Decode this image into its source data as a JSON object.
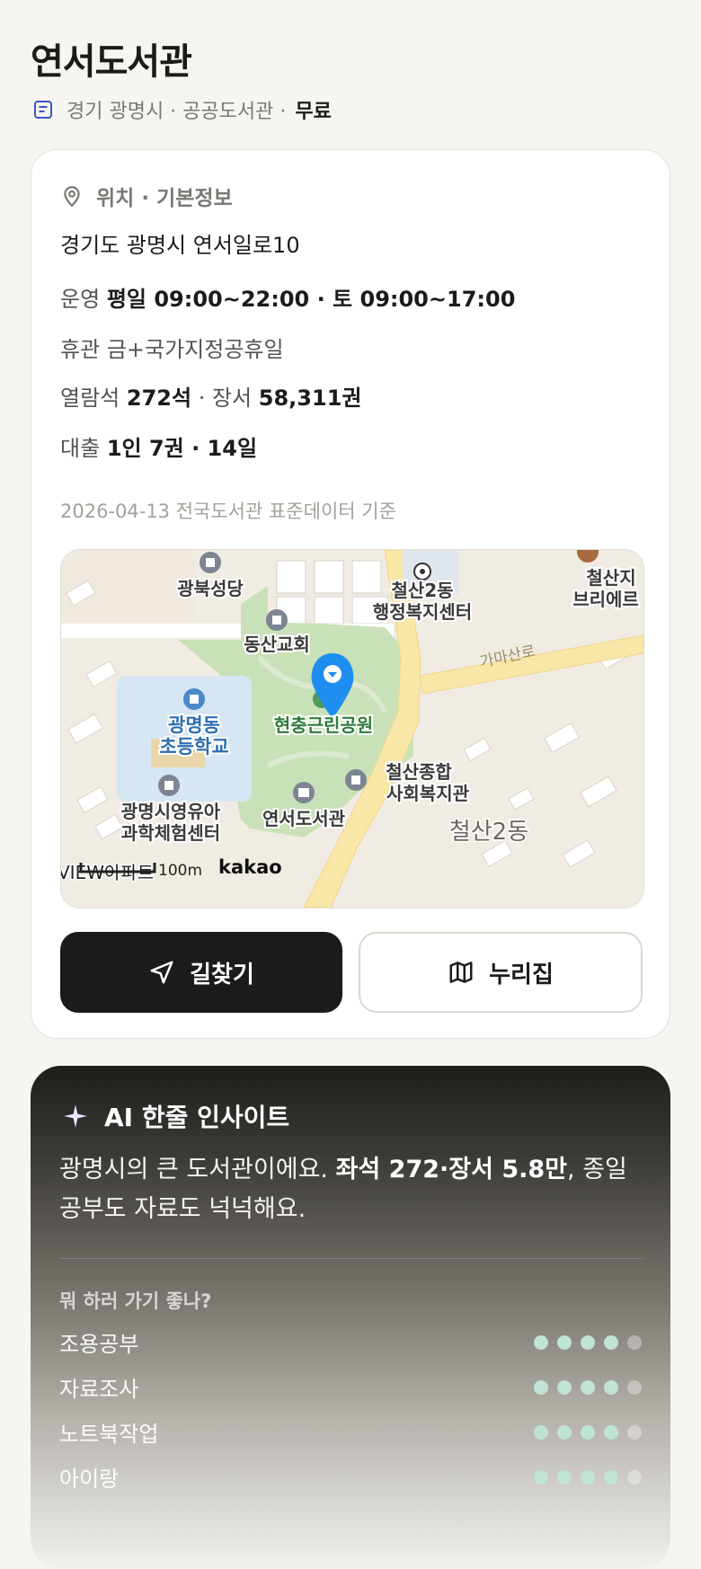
{
  "library": {
    "name": "연서도서관",
    "meta": "경기 광명시 · 공공도서관 ·",
    "fee": "무료"
  },
  "info": {
    "section_title": "위치 · 기본정보",
    "address": "경기도 광명시 연서일로10",
    "hours_label": "운영",
    "hours_value": "평일 09:00~22:00 · 토 09:00~17:00",
    "closed_label": "휴관",
    "closed_value": "금+국가지정공휴일",
    "seats_label": "열람석",
    "seats_value": "272석",
    "books_label": "· 장서",
    "books_value": "58,311권",
    "loan_label": "대출",
    "loan_value": "1인 7권 · 14일",
    "data_stamp": "2026-04-13 전국도서관 표준데이터 기준"
  },
  "map": {
    "labels": {
      "gwangbuk_church": "광북성당",
      "cheolsan2_office_1": "철산2동",
      "cheolsan2_office_2": "행정복지센터",
      "cheolsan_ji_1": "철산지",
      "cheolsan_ji_2": "브리에르",
      "dongsan_church": "동산교회",
      "gama_road": "가마산로",
      "school_1": "광명동",
      "school_2": "초등학교",
      "park": "현충근린공원",
      "welfare_1": "철산종합",
      "welfare_2": "사회복지관",
      "science_1": "광명시영유아",
      "science_2": "과학체험센터",
      "library": "연서도서관",
      "district": "철산2동",
      "apartment": "VIEW아파트",
      "scale": "100m",
      "provider": "kakao"
    },
    "colors": {
      "park": "#c9e1b9",
      "road": "#f9e7a8",
      "school": "#d6e6f2",
      "pin": "#1f8ef1"
    }
  },
  "actions": {
    "route_label": "길찾기",
    "website_label": "누리집"
  },
  "insight": {
    "title": "AI 한줄 인사이트",
    "text_before": "광명시의 큰 도서관이에요. ",
    "text_bold": "좌석 272·장서 5.8만",
    "text_after": ", 종일 공부도 자료도 넉넉해요.",
    "question": "뭐 하러 가기 좋나?",
    "scores": [
      {
        "label": "조용공부",
        "score": 4,
        "max": 5
      },
      {
        "label": "자료조사",
        "score": 4,
        "max": 5
      },
      {
        "label": "노트북작업",
        "score": 4,
        "max": 5
      },
      {
        "label": "아이랑",
        "score": 4,
        "max": 5
      }
    ],
    "dot_on_color": "#bfe3d4"
  }
}
